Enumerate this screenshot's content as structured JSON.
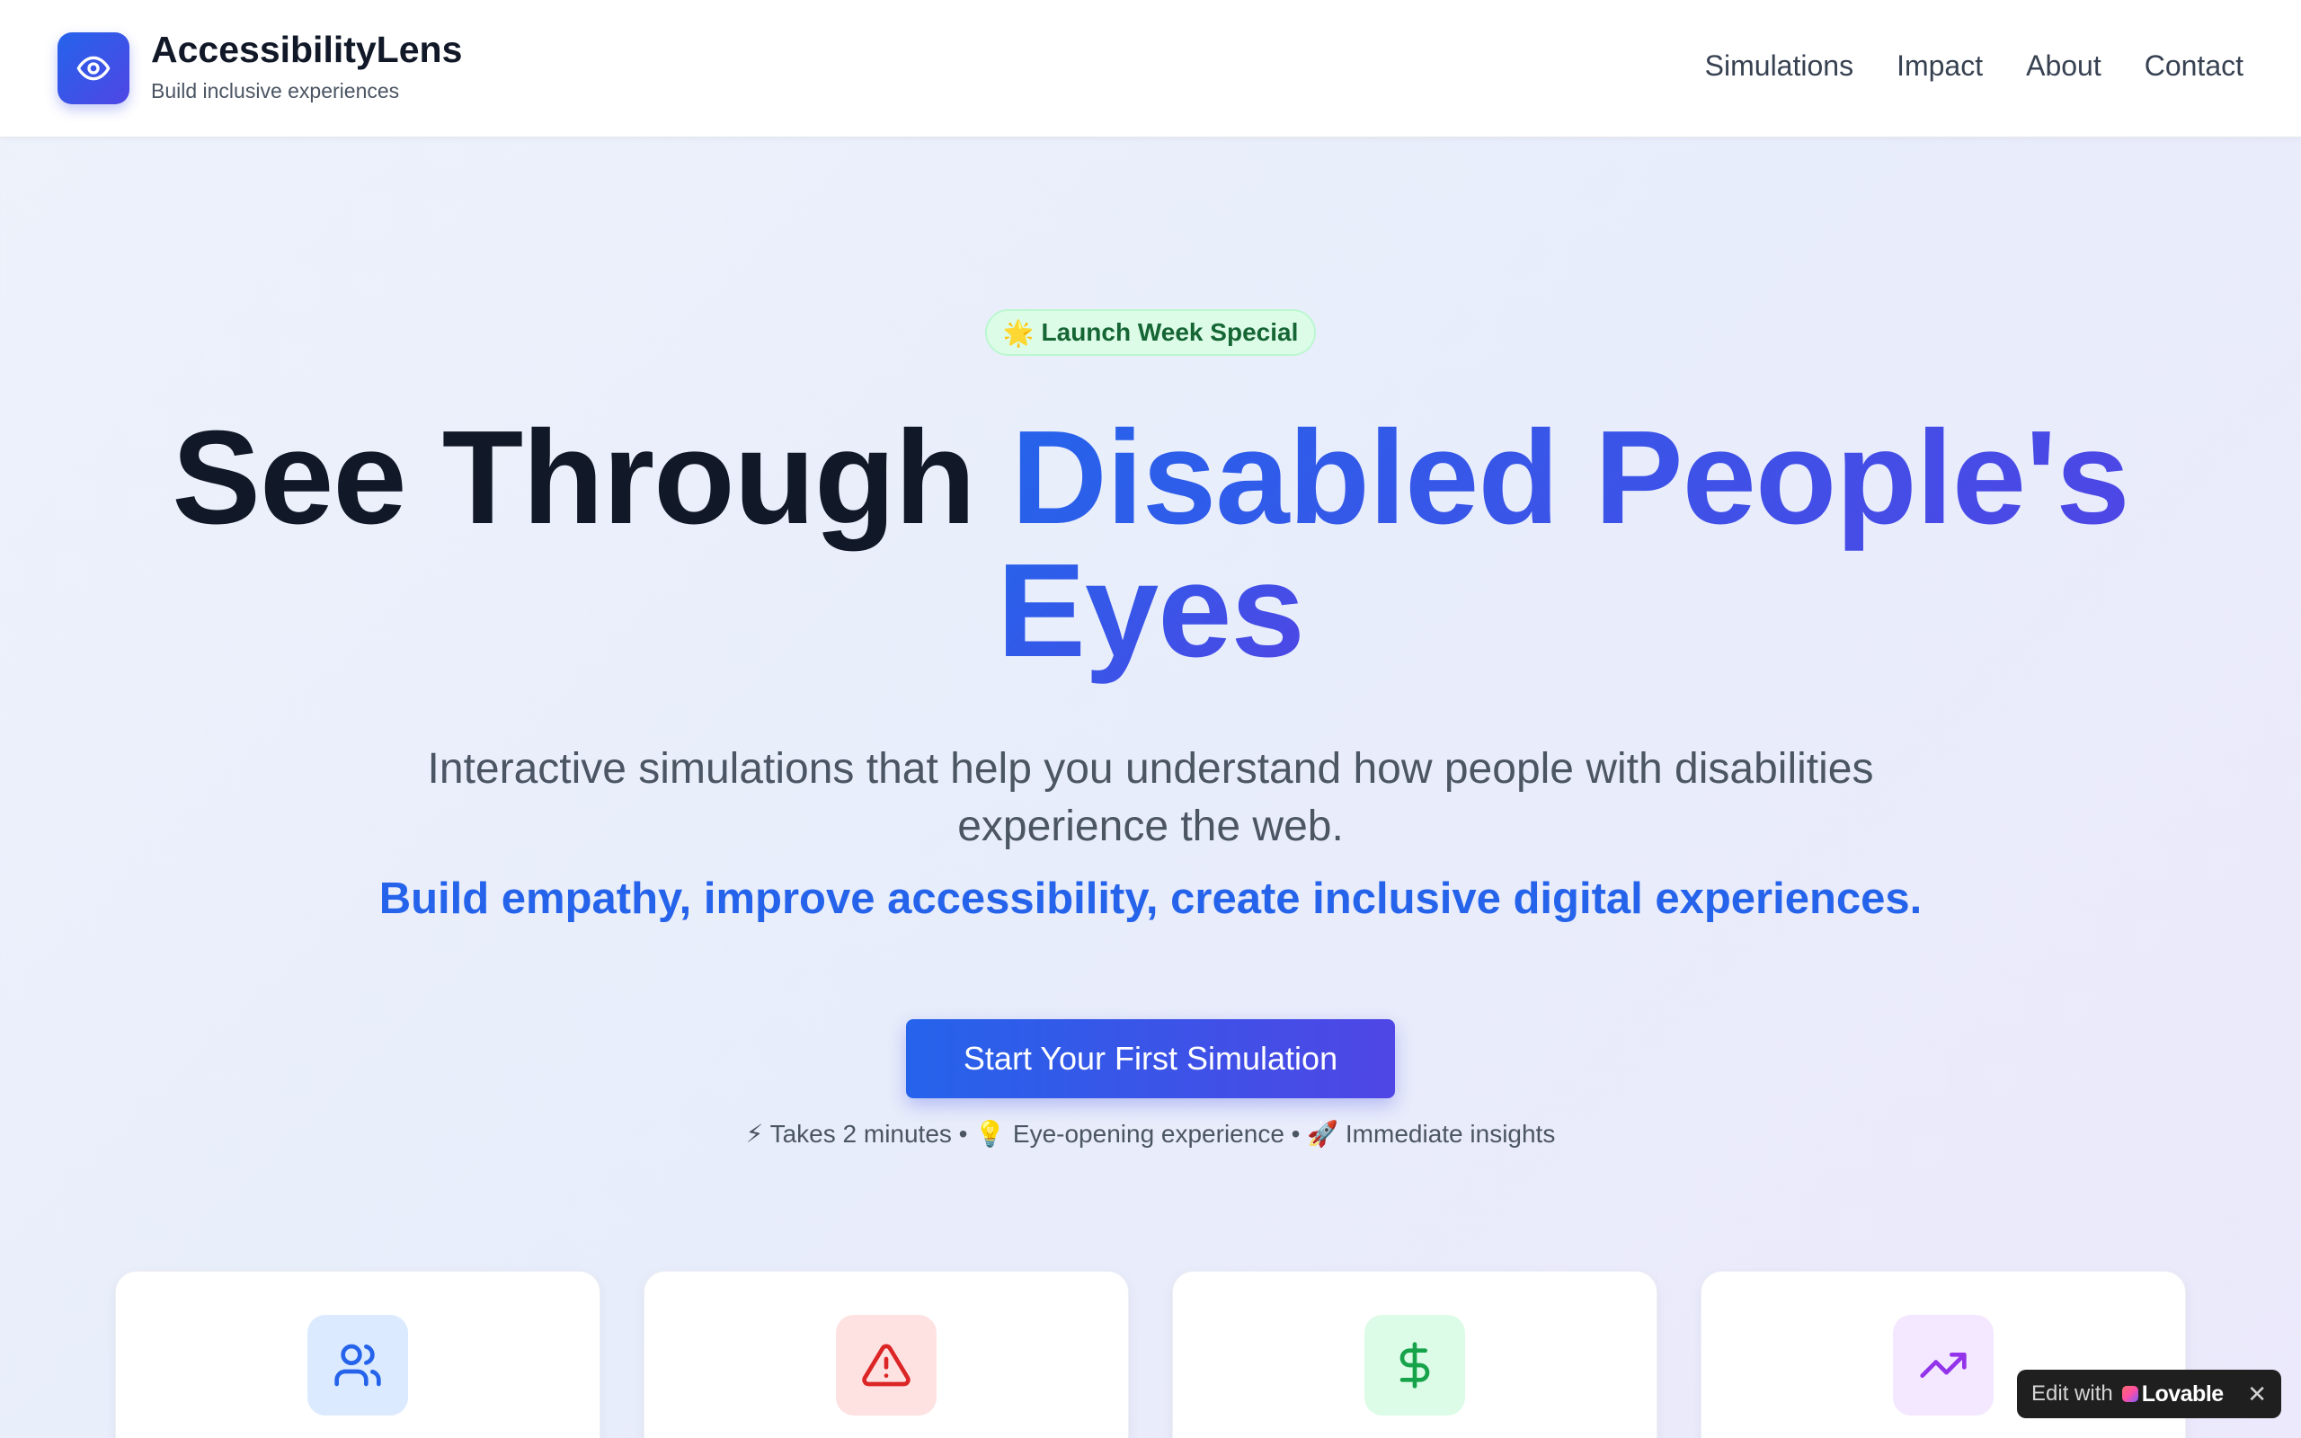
{
  "header": {
    "logo_icon": "eye-icon",
    "brand_name": "AccessibilityLens",
    "tagline": "Build inclusive experiences",
    "nav": [
      {
        "label": "Simulations"
      },
      {
        "label": "Impact"
      },
      {
        "label": "About"
      },
      {
        "label": "Contact"
      }
    ]
  },
  "hero": {
    "badge": {
      "emoji": "🌟",
      "label": "Launch Week Special"
    },
    "headline_plain": "See Through ",
    "headline_highlight_1": "Disabled People's",
    "headline_highlight_2": "Eyes",
    "subtitle": "Interactive simulations that help you understand how people with disabilities experience the web.",
    "subtitle_emphasis": "Build empathy, improve accessibility, create inclusive digital experiences.",
    "cta_label": "Start Your First Simulation",
    "meta": "⚡ Takes 2 minutes • 💡 Eye-opening experience • 🚀 Immediate insights"
  },
  "cards": [
    {
      "icon": "users-icon",
      "color": "#2563eb"
    },
    {
      "icon": "warning-triangle-icon",
      "color": "#dc2626"
    },
    {
      "icon": "dollar-icon",
      "color": "#16a34a"
    },
    {
      "icon": "trending-up-icon",
      "color": "#9333ea"
    }
  ],
  "lovable": {
    "edit_label": "Edit with",
    "brand": "Lovable",
    "close": "✕"
  },
  "colors": {
    "accent_blue": "#2563eb",
    "accent_indigo": "#4f46e5",
    "heading": "#111827",
    "body_text": "#4b5563"
  }
}
